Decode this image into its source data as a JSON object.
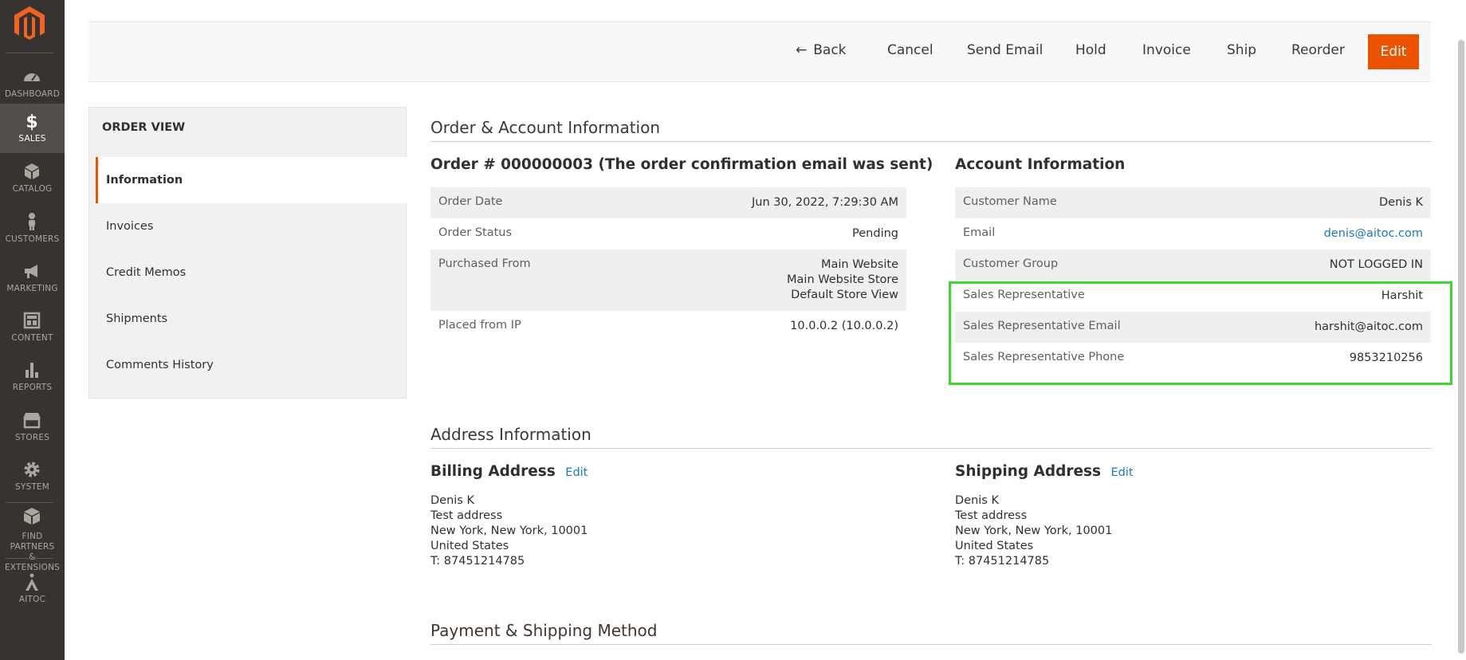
{
  "nav": {
    "items": [
      {
        "label": "DASHBOARD",
        "icon": "dashboard-icon"
      },
      {
        "label": "SALES",
        "icon": "dollar-icon"
      },
      {
        "label": "CATALOG",
        "icon": "cube-icon"
      },
      {
        "label": "CUSTOMERS",
        "icon": "person-icon"
      },
      {
        "label": "MARKETING",
        "icon": "megaphone-icon"
      },
      {
        "label": "CONTENT",
        "icon": "layout-icon"
      },
      {
        "label": "REPORTS",
        "icon": "bar-chart-icon"
      },
      {
        "label": "STORES",
        "icon": "storefront-icon"
      },
      {
        "label": "SYSTEM",
        "icon": "gear-icon"
      },
      {
        "label1": "FIND PARTNERS",
        "label2": "& EXTENSIONS",
        "icon": "package-icon"
      },
      {
        "label": "AITOC",
        "icon": "aitoc-icon"
      }
    ]
  },
  "actions": {
    "back": "Back",
    "cancel": "Cancel",
    "send_email": "Send Email",
    "hold": "Hold",
    "invoice": "Invoice",
    "ship": "Ship",
    "reorder": "Reorder",
    "edit": "Edit"
  },
  "order_view": {
    "title": "ORDER VIEW",
    "tabs": [
      "Information",
      "Invoices",
      "Credit Memos",
      "Shipments",
      "Comments History"
    ]
  },
  "order_account": {
    "section_title": "Order & Account Information",
    "order_title": "Order # 000000003 (The order confirmation email was sent)",
    "order_rows": {
      "date_label": "Order Date",
      "date_value": "Jun 30, 2022, 7:29:30 AM",
      "status_label": "Order Status",
      "status_value": "Pending",
      "purchased_label": "Purchased From",
      "purchased_line1": "Main Website",
      "purchased_line2": "Main Website Store",
      "purchased_line3": "Default Store View",
      "ip_label": "Placed from IP",
      "ip_value": "10.0.0.2 (10.0.0.2)"
    },
    "account_title": "Account Information",
    "account_rows": {
      "name_label": "Customer Name",
      "name_value": "Denis K",
      "email_label": "Email",
      "email_value": "denis@aitoc.com",
      "group_label": "Customer Group",
      "group_value": "NOT LOGGED IN",
      "rep_label": "Sales Representative",
      "rep_value": "Harshit",
      "rep_email_label": "Sales Representative Email",
      "rep_email_value": "harshit@aitoc.com",
      "rep_phone_label": "Sales Representative Phone",
      "rep_phone_value": "9853210256"
    }
  },
  "address": {
    "section_title": "Address Information",
    "billing_title": "Billing Address",
    "shipping_title": "Shipping Address",
    "edit_label": "Edit",
    "billing": [
      "Denis K",
      "Test address",
      "New York, New York, 10001",
      "United States",
      "T: 87451214785"
    ],
    "shipping": [
      "Denis K",
      "Test address",
      "New York, New York, 10001",
      "United States",
      "T: 87451214785"
    ]
  },
  "payment": {
    "section_title": "Payment & Shipping Method"
  },
  "colors": {
    "nav_bg": "#373330",
    "accent": "#eb5202",
    "link": "#1979c3",
    "highlight": "#3ed630"
  }
}
